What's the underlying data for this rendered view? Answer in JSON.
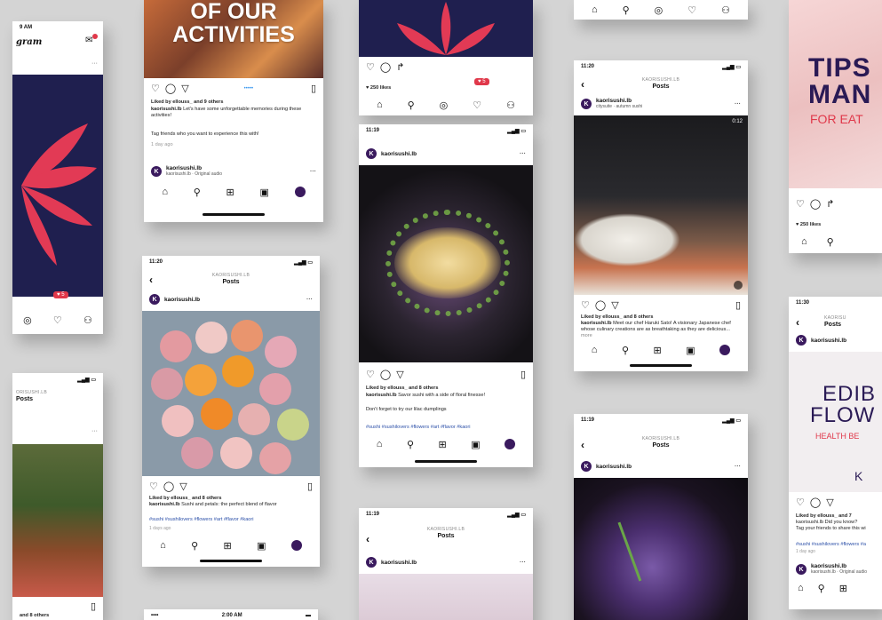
{
  "card1": {
    "time": "9 AM",
    "brand": "gram",
    "likes_badge": "5"
  },
  "card2": {
    "banner": "OF OUR\nACTIVITIES",
    "liked": "Liked by ellouss_ and 9 others",
    "caption_user": "kaorisushi.lb",
    "caption": "Let's have some unforgettable memories during these activities!",
    "caption2": "Tag friends who you want to experience this with!",
    "date": "1 day ago",
    "user": "kaorisushi.lb",
    "audio": "kaorisushi.lb · Original audio"
  },
  "card3": {
    "likes": "250 likes",
    "badge": "5"
  },
  "card4": {
    "time": "11:19",
    "user": "kaorisushi.lb",
    "liked": "Liked by ellouss_ and 8 others",
    "caption_user": "kaorisushi.lb",
    "caption": "Savor sushi with a side of floral finesse!",
    "caption2": "Don't forget to try our lilac dumplings",
    "tags": "#sushi #sushilovers #flowers #art #flavor #kaori"
  },
  "card5": {
    "time": "11:20",
    "kicker": "KAORISUSHI.LB",
    "title": "Posts",
    "user": "kaorisushi.lb",
    "sub": "citysuite · autumn sushi",
    "timer": "0:12",
    "liked": "Liked by ellouss_ and 8 others",
    "caption_user": "kaorisushi.lb",
    "caption": "Meet our chef Haruki Sato! A visionary Japanese chef whose culinary creations are as breathtaking as they are delicious...",
    "more": "more"
  },
  "card6": {
    "banner1": "TIPS",
    "banner2": "MAN",
    "banner3": "FOR EAT",
    "likes": "250 likes"
  },
  "card7": {
    "time": "11:20",
    "kicker": "KAORISUSHI.LB",
    "title": "Posts",
    "user": "kaorisushi.lb",
    "liked": "Liked by ellouss_ and 8 others",
    "caption_user": "kaorisushi.lb",
    "caption": "Sushi and petals: the perfect blend of flavor",
    "tags": "#sushi #sushilovers #flowers #art #flavor #kaori",
    "date": "1 days ago"
  },
  "card8": {
    "kicker": "ORISUSHI.LB",
    "title": "Posts",
    "liked": "and 8 others"
  },
  "card9": {
    "time": "2:00 AM",
    "carrier": "•••• "
  },
  "card10": {
    "time": "11:19",
    "kicker": "KAORISUSHI.LB",
    "title": "Posts",
    "user": "kaorisushi.lb"
  },
  "card11": {
    "time": "11:19",
    "kicker": "KAORISUSHI.LB",
    "title": "Posts",
    "user": "kaorisushi.lb"
  },
  "card12": {
    "time": "11:30",
    "kicker": "KAORISU",
    "title": "Posts",
    "user": "kaorisushi.lb",
    "banner1": "EDIB",
    "banner2": "FLOW",
    "banner3": "HEALTH BE",
    "liked": "Liked by ellouss_ and 7",
    "caption": "kaorisushi.lb Did you know?",
    "caption2": "Tag your friends to share this wi",
    "tags": "#sushi #sushilovers #flowers #a",
    "date": "1 day ago",
    "user2": "kaorisushi.lb",
    "audio": "kaorisushi.lb · Original audio"
  },
  "colors": {
    "brand": "#3a1a5e",
    "accent": "#e0384a",
    "navy": "#1f1f4f",
    "link": "#2b4fa8"
  }
}
